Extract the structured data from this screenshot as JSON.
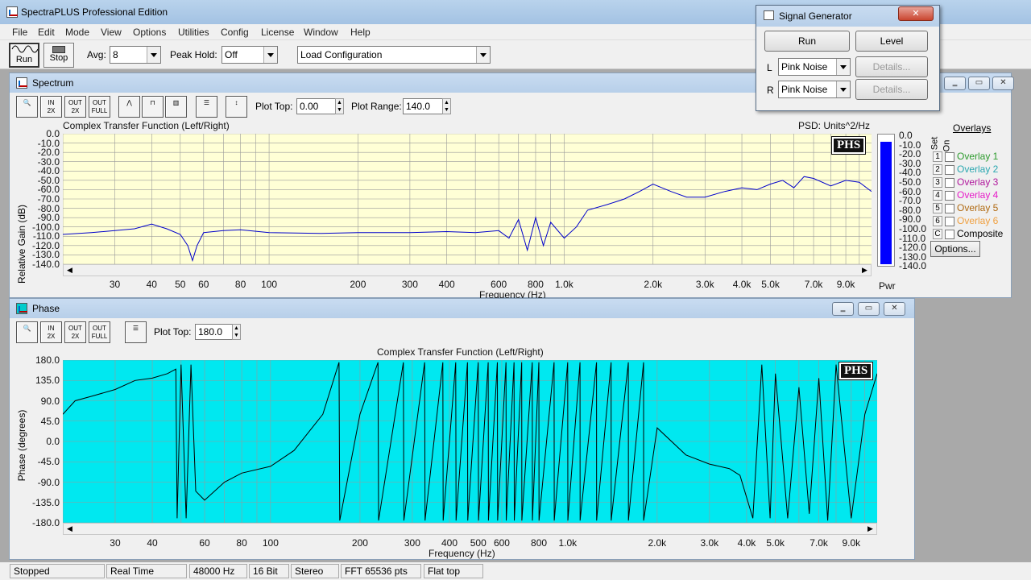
{
  "app": {
    "title": "SpectraPLUS Professional Edition"
  },
  "menu": [
    "File",
    "Edit",
    "Mode",
    "View",
    "Options",
    "Utilities",
    "Config",
    "License",
    "Window",
    "Help"
  ],
  "toolbar": {
    "run": "Run",
    "stop": "Stop",
    "avg_label": "Avg:",
    "avg_value": "8",
    "peak_label": "Peak Hold:",
    "peak_value": "Off",
    "config_value": "Load Configuration"
  },
  "spectrum": {
    "window_title": "Spectrum",
    "plot_top_label": "Plot Top:",
    "plot_top": "0.00",
    "plot_range_label": "Plot Range:",
    "plot_range": "140.0",
    "chart_title": "Complex Transfer Function (Left/Right)",
    "psd_label": "PSD: Units^2/Hz",
    "ylabel": "Relative Gain (dB)",
    "xlabel": "Frequency (Hz)",
    "y_ticks": [
      "0.0",
      "-10.0",
      "-20.0",
      "-30.0",
      "-40.0",
      "-50.0",
      "-60.0",
      "-70.0",
      "-80.0",
      "-90.0",
      "-100.0",
      "-110.0",
      "-120.0",
      "-130.0",
      "-140.0"
    ],
    "x_ticks": [
      "30",
      "40",
      "50",
      "60",
      "80",
      "100",
      "200",
      "300",
      "400",
      "600",
      "800",
      "1.0k",
      "2.0k",
      "3.0k",
      "4.0k",
      "5.0k",
      "7.0k",
      "9.0k"
    ],
    "pwr_label": "Pwr",
    "pwr_ticks": [
      "0.0",
      "-10.0",
      "-20.0",
      "-30.0",
      "-40.0",
      "-50.0",
      "-60.0",
      "-70.0",
      "-80.0",
      "-90.0",
      "-100.0",
      "-110.0",
      "-120.0",
      "-130.0",
      "-140.0"
    ],
    "pwr_level_db": -6,
    "logo": "PHS",
    "colors": {
      "plot_bg": "#ffffd6",
      "trace": "#0000cc",
      "bar": "#0000ff"
    }
  },
  "overlays": {
    "title": "Overlays",
    "set_label": "Set",
    "on_label": "On",
    "items": [
      {
        "num": "1",
        "label": "Overlay 1",
        "color": "#2e9b2e"
      },
      {
        "num": "2",
        "label": "Overlay 2",
        "color": "#2aa7b0"
      },
      {
        "num": "3",
        "label": "Overlay 3",
        "color": "#b0179c"
      },
      {
        "num": "4",
        "label": "Overlay 4",
        "color": "#e61cc8"
      },
      {
        "num": "5",
        "label": "Overlay 5",
        "color": "#b06a12"
      },
      {
        "num": "6",
        "label": "Overlay 6",
        "color": "#f0a040"
      },
      {
        "num": "C",
        "label": "Composite",
        "color": "#000000"
      }
    ],
    "options_button": "Options..."
  },
  "phase": {
    "window_title": "Phase",
    "plot_top_label": "Plot Top:",
    "plot_top": "180.0",
    "chart_title": "Complex Transfer Function (Left/Right)",
    "ylabel": "Phase (degrees)",
    "xlabel": "Frequency (Hz)",
    "y_ticks": [
      "180.0",
      "135.0",
      "90.0",
      "45.0",
      "0.0",
      "-45.0",
      "-90.0",
      "-135.0",
      "-180.0"
    ],
    "x_ticks": [
      "30",
      "40",
      "60",
      "80",
      "100",
      "200",
      "300",
      "400",
      "500",
      "600",
      "800",
      "1.0k",
      "2.0k",
      "3.0k",
      "4.0k",
      "5.0k",
      "7.0k",
      "9.0k"
    ],
    "logo": "PHS",
    "colors": {
      "plot_bg": "#00e8f0",
      "trace": "#000000"
    }
  },
  "signal_generator": {
    "title": "Signal Generator",
    "run": "Run",
    "level": "Level",
    "left_label": "L",
    "left_value": "Pink Noise",
    "right_label": "R",
    "right_value": "Pink Noise",
    "details": "Details..."
  },
  "status": [
    "Stopped",
    "Real Time",
    "48000 Hz",
    "16 Bit",
    "Stereo",
    "FFT 65536 pts",
    "Flat top"
  ],
  "chart_data": [
    {
      "type": "line",
      "title": "Complex Transfer Function (Left/Right)",
      "xlabel": "Frequency (Hz)",
      "ylabel": "Relative Gain (dB)",
      "xscale": "log",
      "xlim": [
        20,
        11000
      ],
      "ylim": [
        -140,
        0
      ],
      "x": [
        20,
        25,
        30,
        35,
        40,
        45,
        50,
        53,
        55,
        57,
        60,
        70,
        80,
        100,
        150,
        200,
        300,
        400,
        500,
        600,
        650,
        700,
        750,
        800,
        850,
        900,
        1000,
        1100,
        1200,
        1400,
        1600,
        1800,
        2000,
        2300,
        2600,
        3000,
        3500,
        4000,
        4500,
        5000,
        5500,
        6000,
        6500,
        7000,
        8000,
        9000,
        10000,
        11000
      ],
      "y": [
        -108,
        -106,
        -104,
        -102,
        -97,
        -102,
        -108,
        -120,
        -136,
        -120,
        -106,
        -104,
        -103,
        -106,
        -107,
        -106,
        -106,
        -105,
        -106,
        -104,
        -112,
        -92,
        -125,
        -90,
        -120,
        -95,
        -112,
        -100,
        -82,
        -76,
        -70,
        -62,
        -54,
        -62,
        -68,
        -68,
        -62,
        -58,
        -60,
        -54,
        -50,
        -58,
        -46,
        -48,
        -56,
        -50,
        -52,
        -62
      ]
    },
    {
      "type": "line",
      "title": "Complex Transfer Function (Left/Right)",
      "xlabel": "Frequency (Hz)",
      "ylabel": "Phase (degrees)",
      "xscale": "log",
      "xlim": [
        20,
        11000
      ],
      "ylim": [
        -180,
        180
      ],
      "x": [
        20,
        22,
        25,
        30,
        35,
        40,
        45,
        48,
        48.5,
        50,
        52,
        54,
        56,
        60,
        70,
        80,
        100,
        120,
        150,
        170,
        171,
        200,
        230,
        231,
        280,
        281,
        330,
        331,
        380,
        381,
        420,
        421,
        460,
        461,
        500,
        501,
        540,
        541,
        580,
        581,
        620,
        621,
        660,
        661,
        700,
        701,
        760,
        761,
        800,
        801,
        900,
        901,
        1000,
        1001,
        1100,
        1101,
        1250,
        1251,
        1400,
        1401,
        1600,
        1601,
        1800,
        1801,
        2000,
        2500,
        3000,
        3500,
        3800,
        4200,
        4500,
        4800,
        5000,
        5500,
        6000,
        6500,
        7000,
        7500,
        8000,
        9000,
        10000,
        11000
      ],
      "y": [
        60,
        90,
        100,
        115,
        135,
        140,
        150,
        160,
        -170,
        170,
        -170,
        170,
        -110,
        -130,
        -90,
        -70,
        -55,
        -20,
        60,
        175,
        -175,
        60,
        175,
        -175,
        175,
        -175,
        175,
        -175,
        175,
        -175,
        175,
        -175,
        175,
        -175,
        175,
        -175,
        175,
        -175,
        175,
        -175,
        175,
        -175,
        175,
        -175,
        175,
        -175,
        175,
        -175,
        175,
        -175,
        175,
        -175,
        175,
        -175,
        175,
        -175,
        175,
        -175,
        175,
        -175,
        175,
        -175,
        175,
        -175,
        30,
        -30,
        -50,
        -60,
        -75,
        -170,
        170,
        -170,
        150,
        -170,
        120,
        -160,
        140,
        -175,
        170,
        -170,
        60,
        150
      ]
    }
  ]
}
